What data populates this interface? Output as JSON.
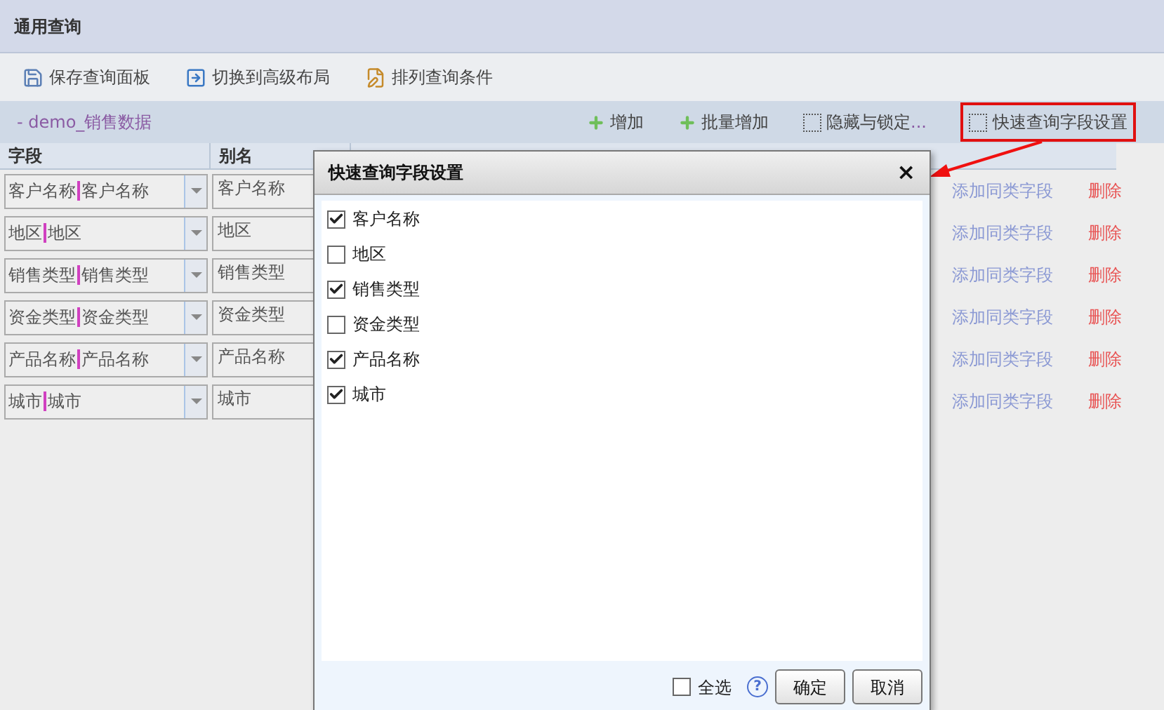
{
  "window": {
    "title": "通用查询"
  },
  "toolbar": [
    {
      "label": "保存查询面板",
      "kind": "save"
    },
    {
      "label": "切换到高级布局",
      "kind": "switch"
    },
    {
      "label": "排列查询条件",
      "kind": "arrange"
    }
  ],
  "section": {
    "title": "- demo_销售数据",
    "actions": [
      {
        "label": "增加",
        "kind": "add"
      },
      {
        "label": "批量增加",
        "kind": "add"
      },
      {
        "label": "隐藏与锁定",
        "suffix": "...",
        "kind": "box",
        "highlighted": false
      },
      {
        "label": "快速查询字段设置",
        "kind": "box",
        "highlighted": true
      }
    ]
  },
  "table": {
    "columns": [
      "字段",
      "别名"
    ],
    "rows": [
      {
        "field": "客户名称",
        "label": "客户名称",
        "alias": "客户名称",
        "link": "添加同类字段",
        "delete": "删除"
      },
      {
        "field": "地区",
        "label": "地区",
        "alias": "地区",
        "link": "添加同类字段",
        "delete": "删除"
      },
      {
        "field": "销售类型",
        "label": "销售类型",
        "alias": "销售类型",
        "link": "添加同类字段",
        "delete": "删除"
      },
      {
        "field": "资金类型",
        "label": "资金类型",
        "alias": "资金类型",
        "link": "添加同类字段",
        "delete": "删除"
      },
      {
        "field": "产品名称",
        "label": "产品名称",
        "alias": "产品名称",
        "link": "添加同类字段",
        "delete": "删除"
      },
      {
        "field": "城市",
        "label": "城市",
        "alias": "城市",
        "link": "添加同类字段",
        "delete": "删除"
      }
    ]
  },
  "dialog": {
    "title": "快速查询字段设置",
    "close": "×",
    "items": [
      {
        "label": "客户名称",
        "checked": true
      },
      {
        "label": "地区",
        "checked": false
      },
      {
        "label": "销售类型",
        "checked": true
      },
      {
        "label": "资金类型",
        "checked": false
      },
      {
        "label": "产品名称",
        "checked": true
      },
      {
        "label": "城市",
        "checked": true
      }
    ],
    "select_all": {
      "label": "全选",
      "checked": false
    },
    "help": "?",
    "buttons": [
      "确定",
      "取消"
    ]
  }
}
